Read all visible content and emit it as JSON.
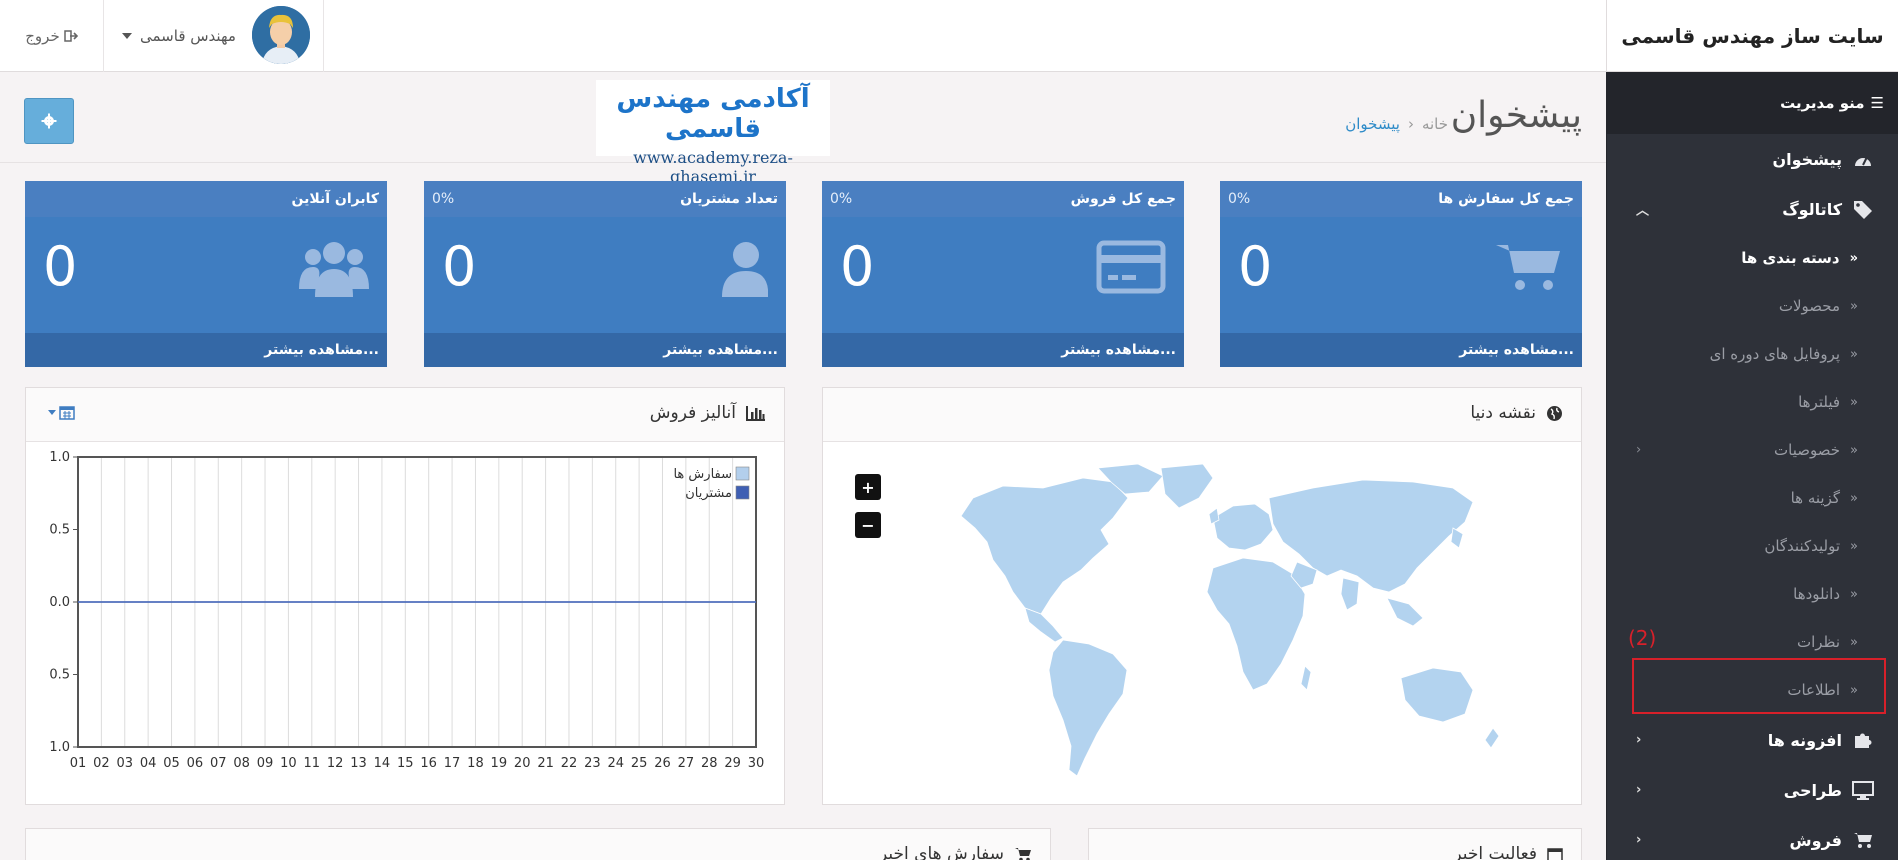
{
  "header": {
    "brand": "سایت ساز مهندس قاسمی",
    "user_name": "مهندس قاسمی",
    "logout_label": "خروج"
  },
  "sidebar": {
    "menu_title": "منو مدیریت",
    "items": [
      {
        "label": "پیشخوان",
        "icon": "dashboard-icon"
      },
      {
        "label": "کاتالوگ",
        "icon": "tags-icon"
      },
      {
        "label": "افزونه ها",
        "icon": "puzzle-icon"
      },
      {
        "label": "طراحی",
        "icon": "desktop-icon"
      },
      {
        "label": "فروش",
        "icon": "cart-icon"
      }
    ],
    "catalog_sub": [
      {
        "label": "دسته بندی ها"
      },
      {
        "label": "محصولات"
      },
      {
        "label": "پروفایل های دوره ای"
      },
      {
        "label": "فیلترها"
      },
      {
        "label": "خصوصیات"
      },
      {
        "label": "گزینه ها"
      },
      {
        "label": "تولیدکنندگان"
      },
      {
        "label": "دانلودها"
      },
      {
        "label": "نظرات"
      },
      {
        "label": "اطلاعات"
      }
    ],
    "highlight_label": "(2)"
  },
  "page": {
    "title": "پیشخوان",
    "breadcrumb": [
      "خانه",
      "پیشخوان"
    ],
    "academy_title": "آکادمی مهندس قاسمی",
    "academy_url": "www.academy.reza-ghasemi.ir"
  },
  "tiles": [
    {
      "title": "جمع کل سفارش ها",
      "percent": "0%",
      "value": "0",
      "footer": "مشاهده بیشتر...",
      "icon": "cart-icon"
    },
    {
      "title": "جمع کل فروش",
      "percent": "0%",
      "value": "0",
      "footer": "مشاهده بیشتر...",
      "icon": "credit-card-icon"
    },
    {
      "title": "تعداد مشتریان",
      "percent": "0%",
      "value": "0",
      "footer": "مشاهده بیشتر...",
      "icon": "user-icon"
    },
    {
      "title": "کابران آنلاین",
      "percent": "",
      "value": "0",
      "footer": "مشاهده بیشتر...",
      "icon": "users-icon"
    }
  ],
  "map_panel": {
    "title": "نقشه دنیا",
    "zoom_in": "+",
    "zoom_out": "−"
  },
  "chart_panel": {
    "title": "آنالیز فروش"
  },
  "bottom_panels": [
    {
      "title": "فعالیت اخیر"
    },
    {
      "title": "سفارش های اخیر"
    }
  ],
  "chart_data": {
    "type": "line",
    "categories": [
      "01",
      "02",
      "03",
      "04",
      "05",
      "06",
      "07",
      "08",
      "09",
      "10",
      "11",
      "12",
      "13",
      "14",
      "15",
      "16",
      "17",
      "18",
      "19",
      "20",
      "21",
      "22",
      "23",
      "24",
      "25",
      "26",
      "27",
      "28",
      "29",
      "30"
    ],
    "yticks": [
      "1.0",
      "0.5",
      "0.0",
      "0.5",
      "1.0"
    ],
    "ylim": [
      -1,
      1
    ],
    "series": [
      {
        "name": "سفارش ها",
        "color": "#b3cfec",
        "values": [
          0,
          0,
          0,
          0,
          0,
          0,
          0,
          0,
          0,
          0,
          0,
          0,
          0,
          0,
          0,
          0,
          0,
          0,
          0,
          0,
          0,
          0,
          0,
          0,
          0,
          0,
          0,
          0,
          0,
          0
        ]
      },
      {
        "name": "مشتریان",
        "color": "#3f5fb3",
        "values": [
          0,
          0,
          0,
          0,
          0,
          0,
          0,
          0,
          0,
          0,
          0,
          0,
          0,
          0,
          0,
          0,
          0,
          0,
          0,
          0,
          0,
          0,
          0,
          0,
          0,
          0,
          0,
          0,
          0,
          0
        ]
      }
    ],
    "legend": "top-right",
    "grid": true
  }
}
